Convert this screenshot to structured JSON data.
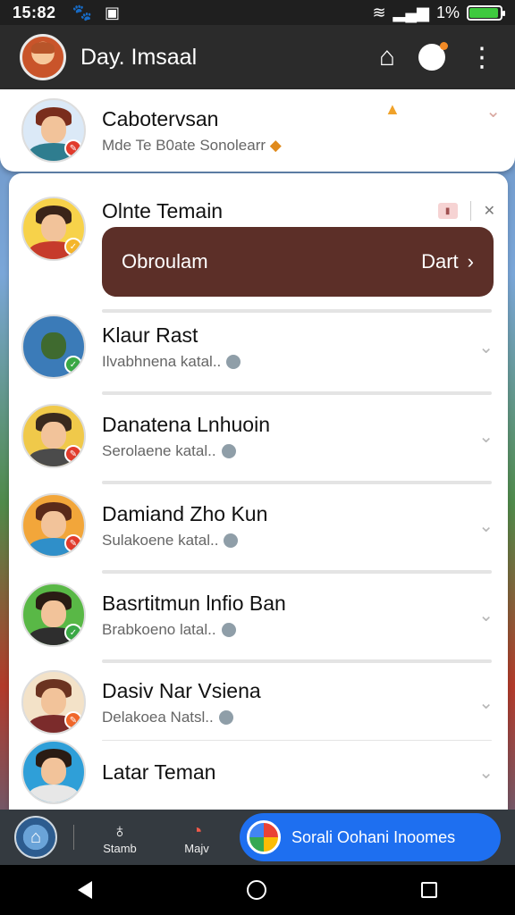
{
  "status_bar": {
    "time": "15:82",
    "battery": "1%",
    "battery_fill": 0.95
  },
  "app_bar": {
    "title": "Day. Imsaal",
    "icons": [
      "home-icon",
      "smile-icon",
      "more-vert-icon"
    ]
  },
  "top_item": {
    "name": "Cabotervsan",
    "subtitle": "Mde Te B0ate Sonolearr"
  },
  "highlight_item": {
    "name": "Olnte Temain",
    "action_label": "Obroulam",
    "action_right": "Dart"
  },
  "list": [
    {
      "name": "Klaur Rast",
      "sub": "Ilvabhnena katal..",
      "badge_color": "#3aa845"
    },
    {
      "name": "Danatena Lnhuoin",
      "sub": "Serolaene katal..",
      "badge_color": "#e13b2c"
    },
    {
      "name": "Damiand Zho Kun",
      "sub": "Sulakoene katal..",
      "badge_color": "#e13b2c"
    },
    {
      "name": "Basrtitmun lnfio Ban",
      "sub": "Brabkoeno latal..",
      "badge_color": "#3aa845"
    },
    {
      "name": "Dasiv Nar Vsiena",
      "sub": "Delakoea Natsl..",
      "badge_color": "#f0672a"
    },
    {
      "name": "Latar Teman",
      "sub": "",
      "badge_color": ""
    }
  ],
  "bottom_bar": {
    "item1_label": "Stamb",
    "item2_label": "Majv",
    "cta_label": "Sorali Oohani Inoomes"
  }
}
